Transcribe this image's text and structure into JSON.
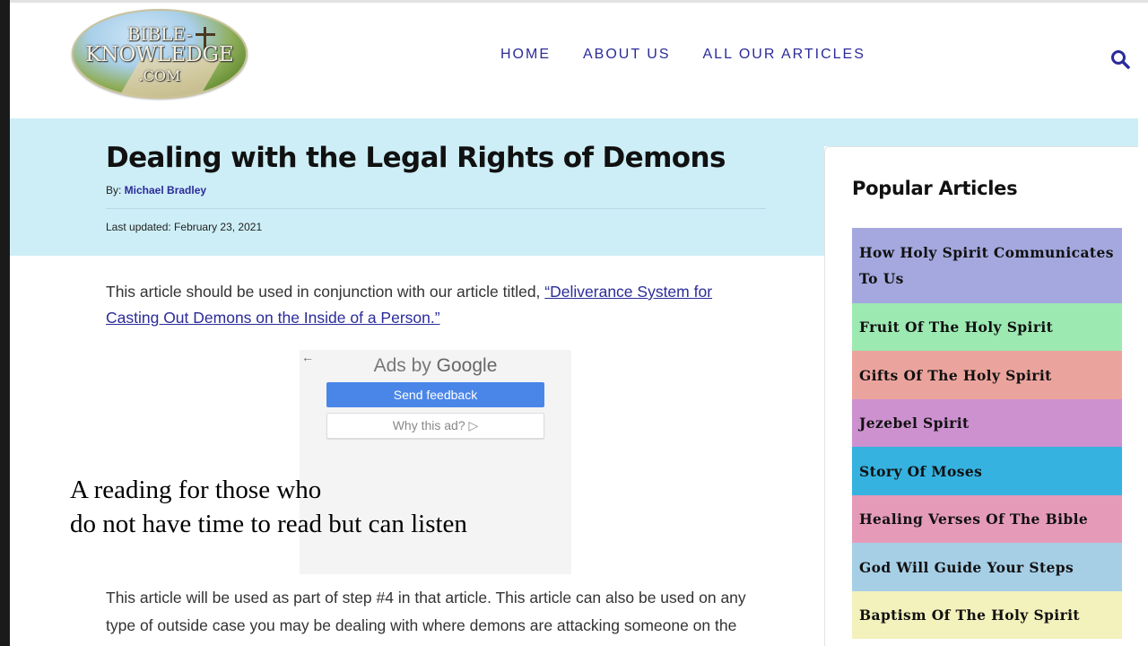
{
  "header": {
    "logo": {
      "line1": "BIBLE-",
      "line2": "KNOWLEDGE",
      "line3": ".COM"
    },
    "nav": [
      {
        "label": "HOME"
      },
      {
        "label": "ABOUT US"
      },
      {
        "label": "ALL OUR ARTICLES"
      }
    ]
  },
  "article": {
    "title": "Dealing with the Legal Rights of Demons",
    "by_label": "By: ",
    "author": "Michael Bradley",
    "updated": "Last updated: February 23, 2021",
    "p1_text": "This article should be used in conjunction with our article titled, ",
    "p1_link": "“Deliverance System for Casting Out Demons on the Inside of a Person.”",
    "p2_text": "This article will be used as part of step #4 in that article. This article can also be used on any type of outside case you may be dealing with where demons are attacking someone on the"
  },
  "ad": {
    "back": "←",
    "title_prefix": "Ads by ",
    "title_brand": "Google",
    "send_feedback": "Send feedback",
    "why": "Why this ad? ▷"
  },
  "overlay": {
    "line1": "A reading for those who",
    "line2": "do not have time to read but can listen"
  },
  "sidebar": {
    "heading": "Popular Articles",
    "items": [
      {
        "label": "How Holy Spirit Communicates To Us",
        "color": "#a4a8de"
      },
      {
        "label": "Fruit Of The Holy Spirit",
        "color": "#9ce9b2"
      },
      {
        "label": "Gifts Of The Holy Spirit",
        "color": "#eba49d"
      },
      {
        "label": "Jezebel Spirit",
        "color": "#cd91d0"
      },
      {
        "label": "Story Of Moses",
        "color": "#35b2e0"
      },
      {
        "label": "Healing Verses Of The Bible",
        "color": "#e59bb8"
      },
      {
        "label": "God Will Guide Your Steps",
        "color": "#a6cfe6"
      },
      {
        "label": "Baptism Of The Holy Spirit",
        "color": "#f3f1bc"
      }
    ]
  },
  "colors": {
    "nav": "#2b2b9a",
    "title_band": "#cdeef6",
    "ad_button": "#4a86e8"
  }
}
